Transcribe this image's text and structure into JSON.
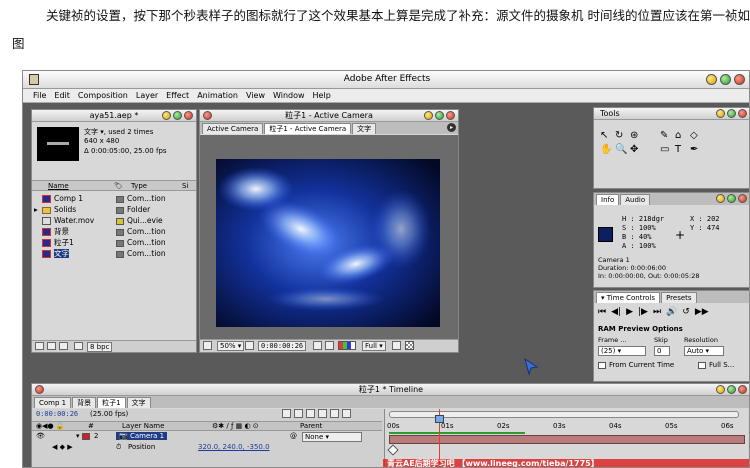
{
  "article": {
    "line1": "关键祯的设置，按下那个秒表样子的图标就行了这个效果基本上算是完成了补充：源文件的摄象机 时间线的位置应该在第一祯如",
    "line2": "图"
  },
  "app": {
    "title": "Adobe After Effects",
    "menu": [
      "File",
      "Edit",
      "Composition",
      "Layer",
      "Effect",
      "Animation",
      "View",
      "Window",
      "Help"
    ]
  },
  "project": {
    "title": "aya51.aep *",
    "info_name": "文字 ▾, used 2 times",
    "info_size": "640 x 480",
    "info_dur": "Δ 0:00:05:00, 25.00 fps",
    "col_name": "Name",
    "col_type": "Type",
    "col_size": "Si",
    "items": [
      {
        "name": "Comp 1",
        "type": "Com...tion",
        "icon": "comp"
      },
      {
        "name": "Solids",
        "type": "Folder",
        "icon": "folder"
      },
      {
        "name": "Water.mov",
        "type": "Qui...evie",
        "icon": "movie"
      },
      {
        "name": "背景",
        "type": "Com...tion",
        "icon": "comp"
      },
      {
        "name": "粒子1",
        "type": "Com...tion",
        "icon": "comp"
      },
      {
        "name": "文字",
        "type": "Com...tion",
        "icon": "comp"
      }
    ],
    "bpc": "8 bpc"
  },
  "composition": {
    "title": "粒子1 - Active Camera",
    "tabs": [
      "Active Camera",
      "粒子1 - Active Camera",
      "文字"
    ],
    "zoom": "50%",
    "timecode": "0:00:00:26",
    "resolution": "Full"
  },
  "tools": {
    "title": "Tools"
  },
  "info": {
    "tabs": [
      "Info",
      "Audio"
    ],
    "h": "H : 218dgr",
    "s": "S :   100%",
    "b": "B :    40%",
    "a": "A :   100%",
    "x": "X :    202",
    "y": "Y :    474",
    "cam": "Camera 1",
    "duration": "Duration: 0:00:06:00",
    "inout": "In: 0:00:00:00, Out: 0:00:05:28",
    "swatch": "#0c1f5e"
  },
  "time_controls": {
    "tabs": [
      "Time Controls",
      "Presets"
    ],
    "ram": "RAM Preview Options",
    "frame_label": "Frame ...",
    "skip_label": "Skip",
    "res_label": "Resolution",
    "frame_val": "(25)",
    "skip_val": "0",
    "res_val": "Auto",
    "from_current": "From Current Time",
    "full_screen": "Full S..."
  },
  "timeline": {
    "title": "粒子1 * Timeline",
    "tabs": [
      "Comp 1",
      "背景",
      "粒子1",
      "文字"
    ],
    "timecode": "0:00:00:26",
    "fps": "(25.00 fps)",
    "col_layer": "Layer Name",
    "col_parent": "Parent",
    "layer_num": "2",
    "layer_name": "Camera 1",
    "parent_val": "None",
    "prop_name": "Position",
    "prop_val": "320.0, 240.0, -350.0",
    "ruler": [
      "00s",
      "01s",
      "02s",
      "03s",
      "04s",
      "05s",
      "06s"
    ]
  },
  "watermark": "青云AE后期学习吧  【www.lineeg.com/tieba/1775】"
}
